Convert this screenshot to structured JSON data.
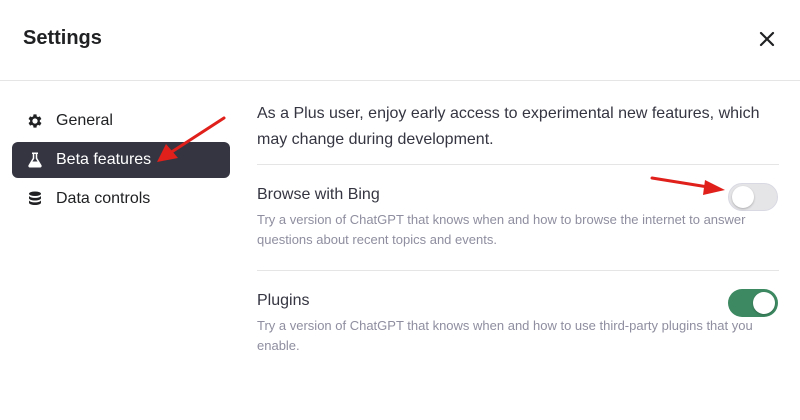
{
  "header": {
    "title": "Settings",
    "close_icon": "close-icon"
  },
  "sidebar": {
    "items": [
      {
        "label": "General",
        "icon": "gear-icon",
        "active": false
      },
      {
        "label": "Beta features",
        "icon": "flask-icon",
        "active": true
      },
      {
        "label": "Data controls",
        "icon": "database-icon",
        "active": false
      }
    ]
  },
  "main": {
    "intro": "As a Plus user, enjoy early access to experimental new features, which may change during development.",
    "features": [
      {
        "name": "Browse with Bing",
        "description": "Try a version of ChatGPT that knows when and how to browse the internet to answer questions about recent topics and events.",
        "enabled": false
      },
      {
        "name": "Plugins",
        "description": "Try a version of ChatGPT that knows when and how to use third-party plugins that you enable.",
        "enabled": true
      }
    ]
  },
  "colors": {
    "active_item_bg": "#343541",
    "toggle_on": "#3d8a62",
    "toggle_off": "#e5e5e8",
    "annotation_arrow": "#e0201b"
  }
}
